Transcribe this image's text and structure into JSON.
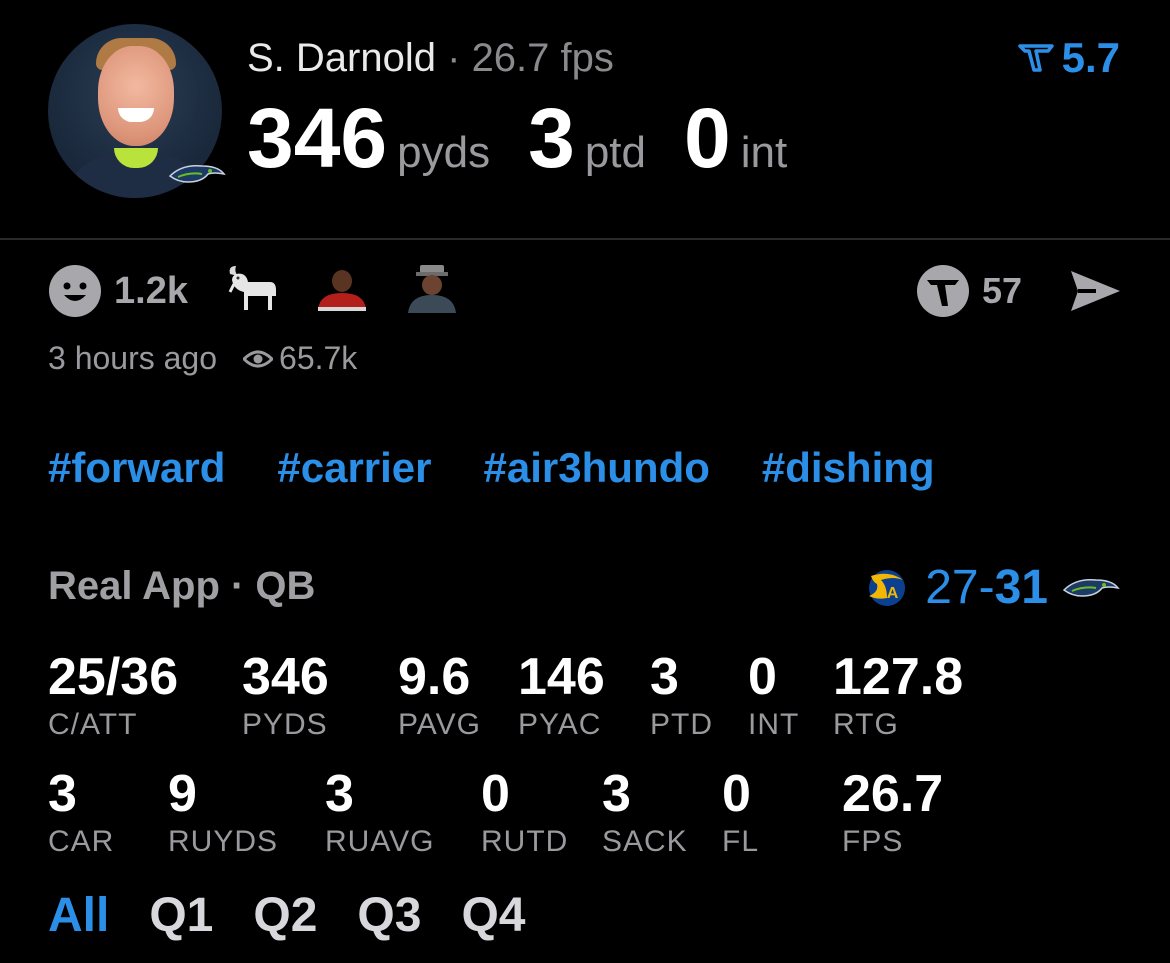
{
  "player": {
    "name": "S. Darnold",
    "separator": "·",
    "fps": "26.7 fps",
    "pyds": "346",
    "pyds_unit": "pyds",
    "ptd": "3",
    "ptd_unit": "ptd",
    "int": "0",
    "int_unit": "int"
  },
  "top_score": "5.7",
  "reactions": {
    "count": "1.2k",
    "emojis": [
      "goat-emoji",
      "player-avatar-1",
      "player-avatar-2"
    ]
  },
  "likes": "57",
  "meta": {
    "time": "3 hours ago",
    "views": "65.7k"
  },
  "tags": [
    "#forward",
    "#carrier",
    "#air3hundo",
    "#dishing"
  ],
  "app_line": "Real App · QB",
  "game": {
    "away_team_icon": "rams-logo-icon",
    "score_left": "27",
    "score_dash": "-",
    "score_right": "31",
    "home_team_icon": "seahawks-logo-icon"
  },
  "stats_row1": [
    {
      "value": "25/36",
      "label": "C/ATT"
    },
    {
      "value": "346",
      "label": "PYDS"
    },
    {
      "value": "9.6",
      "label": "PAVG"
    },
    {
      "value": "146",
      "label": "PYAC"
    },
    {
      "value": "3",
      "label": "PTD"
    },
    {
      "value": "0",
      "label": "INT"
    },
    {
      "value": "127.8",
      "label": "RTG"
    }
  ],
  "stats_row2": [
    {
      "value": "3",
      "label": "CAR"
    },
    {
      "value": "9",
      "label": "RUYDS"
    },
    {
      "value": "3",
      "label": "RUAVG"
    },
    {
      "value": "0",
      "label": "RUTD"
    },
    {
      "value": "3",
      "label": "SACK"
    },
    {
      "value": "0",
      "label": "FL"
    },
    {
      "value": "26.7",
      "label": "FPS"
    }
  ],
  "quarters": [
    "All",
    "Q1",
    "Q2",
    "Q3",
    "Q4"
  ],
  "colors": {
    "accent": "#2b8fe8",
    "background": "#000000",
    "muted": "#9a9a9e"
  }
}
